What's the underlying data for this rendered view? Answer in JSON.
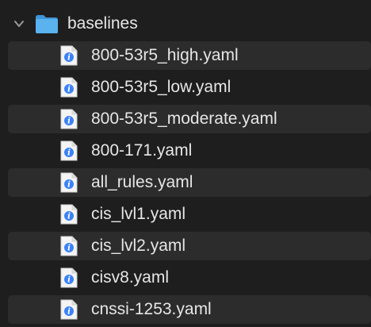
{
  "folder": {
    "name": "baselines",
    "expanded": true,
    "icon": "folder-icon",
    "color": "#4aa6e8"
  },
  "files": [
    {
      "name": "800-53r5_high.yaml",
      "icon": "yaml-file-icon"
    },
    {
      "name": "800-53r5_low.yaml",
      "icon": "yaml-file-icon"
    },
    {
      "name": "800-53r5_moderate.yaml",
      "icon": "yaml-file-icon"
    },
    {
      "name": "800-171.yaml",
      "icon": "yaml-file-icon"
    },
    {
      "name": "all_rules.yaml",
      "icon": "yaml-file-icon"
    },
    {
      "name": "cis_lvl1.yaml",
      "icon": "yaml-file-icon"
    },
    {
      "name": "cis_lvl2.yaml",
      "icon": "yaml-file-icon"
    },
    {
      "name": "cisv8.yaml",
      "icon": "yaml-file-icon"
    },
    {
      "name": "cnssi-1253.yaml",
      "icon": "yaml-file-icon"
    }
  ],
  "colors": {
    "background": "#1e1e1e",
    "alt_row": "#2c2c2c",
    "text": "#e6e6e6",
    "file_badge": "#3b82f6"
  }
}
